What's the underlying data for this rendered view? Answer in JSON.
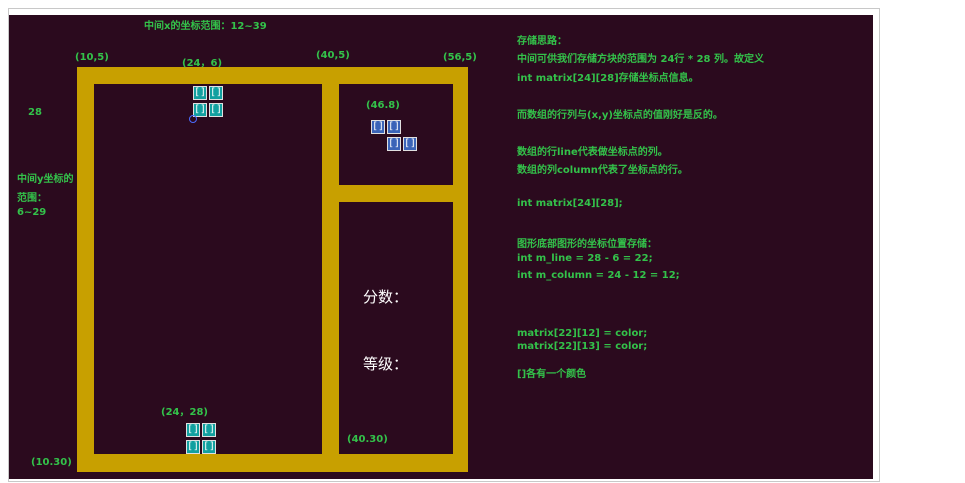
{
  "labels": {
    "x_range": "中间x的坐标范围：12~39",
    "tl": "(10,5)",
    "top_block": "(24，6)",
    "mid_top": "(40,5)",
    "tr": "(56,5)",
    "left_28": "28",
    "y_range_1": "中间y坐标的",
    "y_range_2": "范围：",
    "y_range_3": "6~29",
    "next_block": "(46.8)",
    "bottom_block": "(24，28)",
    "bl": "(10.30)",
    "mid_bottom": "(40.30)",
    "score": "分数：",
    "level": "等级："
  },
  "block_glyph": "[]",
  "notes": [
    "存储思路：",
    "中间可供我们存储方块的范围为 24行 * 28 列。故定义",
    "int  matrix[24][28]存储坐标点信息。",
    "而数组的行列与(x,y)坐标点的值刚好是反的。",
    "数组的行line代表做坐标点的列。",
    "数组的列column代表了坐标点的行。",
    "int  matrix[24][28];",
    "图形底部图形的坐标位置存储：",
    "int m_line    =    28 - 6 = 22;",
    "int m_column = 24 - 12 = 12;",
    "matrix[22][12] = color;",
    "matrix[22][13] = color;",
    "[]各有一个颜色"
  ],
  "colors": {
    "background": "#2b0a1e",
    "frame": "#c8a000",
    "label": "#33c24a",
    "block_teal": "#12a0a0",
    "block_blue": "#3b64b8"
  }
}
